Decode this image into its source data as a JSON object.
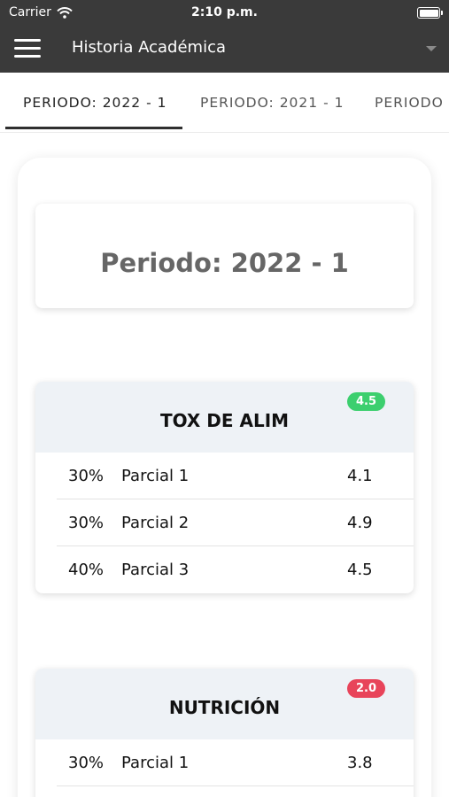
{
  "status": {
    "carrier": "Carrier",
    "time": "2:10 p.m."
  },
  "app_bar": {
    "title": "Historia Académica"
  },
  "tabs": [
    {
      "label": "PERIODO: 2022 - 1",
      "active": true
    },
    {
      "label": "PERIODO: 2021 - 1",
      "active": false
    },
    {
      "label": "PERIODO",
      "active": false
    }
  ],
  "period": {
    "title": "Periodo: 2022 - 1"
  },
  "courses": [
    {
      "name": "TOX DE ALIM",
      "grade": "4.5",
      "badge_color": "#3ccf6e",
      "rows": [
        {
          "percent": "30%",
          "label": "Parcial 1",
          "value": "4.1"
        },
        {
          "percent": "30%",
          "label": "Parcial 2",
          "value": "4.9"
        },
        {
          "percent": "40%",
          "label": "Parcial 3",
          "value": "4.5"
        }
      ]
    },
    {
      "name": "NUTRICIÓN",
      "grade": "2.0",
      "badge_color": "#e8445a",
      "rows": [
        {
          "percent": "30%",
          "label": "Parcial 1",
          "value": "3.8"
        }
      ]
    }
  ]
}
